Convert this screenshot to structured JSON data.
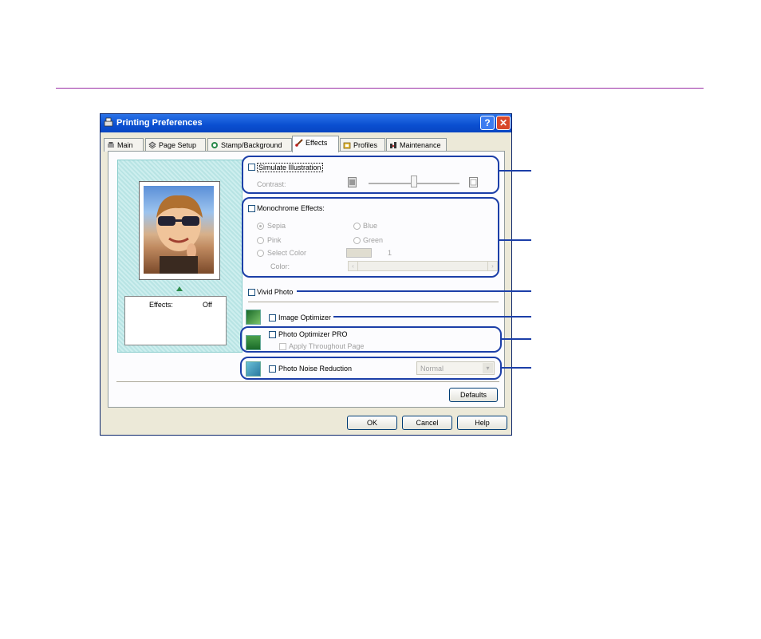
{
  "window": {
    "title": "Printing Preferences",
    "help_label": "?",
    "close_label": "✕"
  },
  "tabs": [
    {
      "label": "Main",
      "icon": "printer-icon"
    },
    {
      "label": "Page Setup",
      "icon": "page-setup-icon"
    },
    {
      "label": "Stamp/Background",
      "icon": "stamp-icon"
    },
    {
      "label": "Effects",
      "icon": "effects-brush-icon",
      "active": true
    },
    {
      "label": "Profiles",
      "icon": "profiles-icon"
    },
    {
      "label": "Maintenance",
      "icon": "maintenance-icon"
    }
  ],
  "preview": {
    "effects_label": "Effects:",
    "effects_value": "Off"
  },
  "simulate": {
    "label": "Simulate Illustration",
    "contrast_label": "Contrast:",
    "slider_level": 0.5
  },
  "monochrome": {
    "label": "Monochrome Effects:",
    "options": {
      "sepia": "Sepia",
      "blue": "Blue",
      "pink": "Pink",
      "green": "Green",
      "select_color": "Select Color"
    },
    "select_value": "1",
    "color_label": "Color:"
  },
  "vivid": {
    "label": "Vivid Photo"
  },
  "image_optimizer": {
    "label": "Image Optimizer"
  },
  "photo_optimizer": {
    "label": "Photo Optimizer PRO",
    "apply_label": "Apply Throughout Page"
  },
  "noise": {
    "label": "Photo Noise Reduction",
    "value": "Normal"
  },
  "buttons": {
    "defaults": "Defaults",
    "ok": "OK",
    "cancel": "Cancel",
    "help": "Help"
  },
  "colors": {
    "highlight": "#1c3fa8",
    "title_bar": "#0a4fd1",
    "rule": "#9b2fa6"
  }
}
